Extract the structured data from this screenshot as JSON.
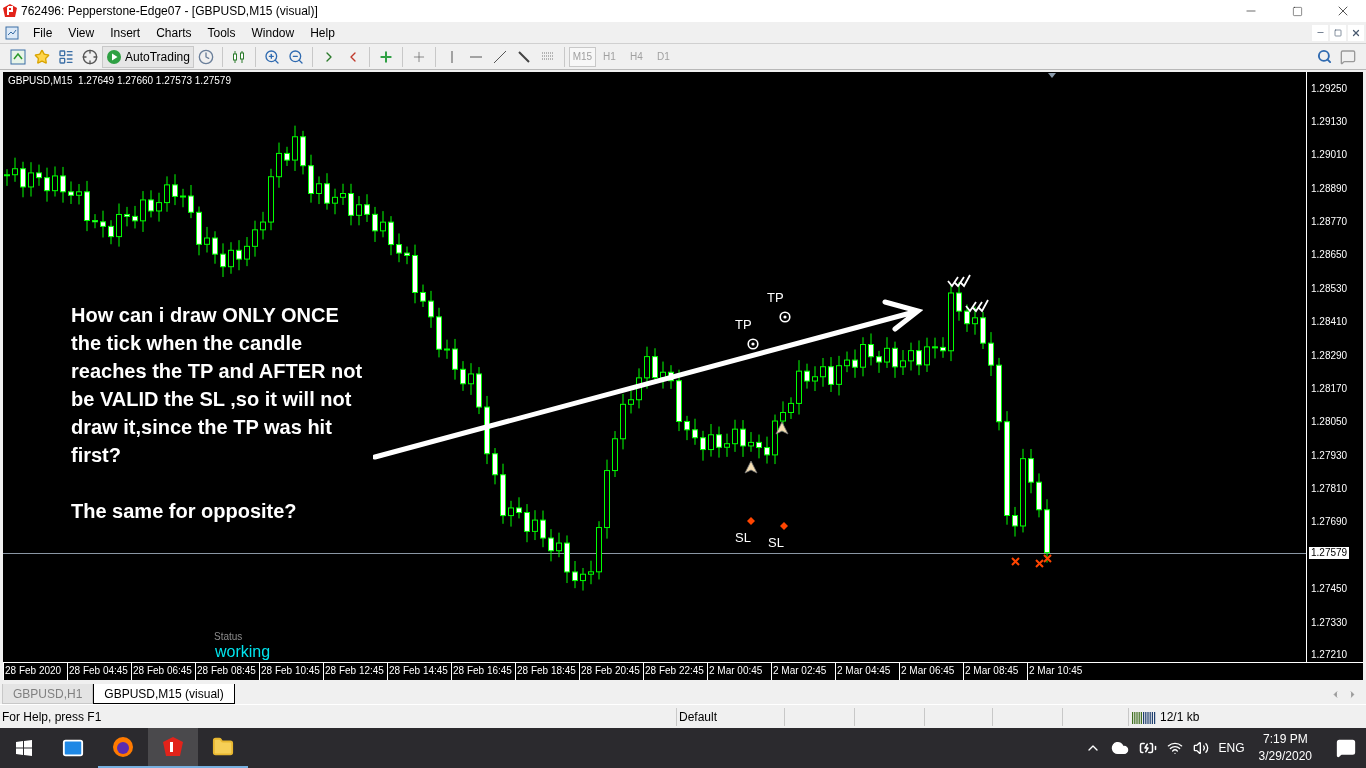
{
  "window": {
    "title": "762496: Pepperstone-Edge07 - [GBPUSD,M15 (visual)]"
  },
  "menu": [
    "File",
    "View",
    "Insert",
    "Charts",
    "Tools",
    "Window",
    "Help"
  ],
  "toolbar": {
    "autotrading": "AutoTrading",
    "timeframes": [
      {
        "label": "M15",
        "selected": true
      },
      {
        "label": "H1",
        "selected": false
      },
      {
        "label": "H4",
        "selected": false
      },
      {
        "label": "D1",
        "selected": false
      }
    ]
  },
  "chart": {
    "info": "GBPUSD,M15  1.27649 1.27660 1.27573 1.27579",
    "price_ticks": [
      "1.29250",
      "1.29130",
      "1.29010",
      "1.28890",
      "1.28770",
      "1.28650",
      "1.28530",
      "1.28410",
      "1.28290",
      "1.28170",
      "1.28050",
      "1.27930",
      "1.27810",
      "1.27690",
      "1.27450",
      "1.27330",
      "1.27210"
    ],
    "current_price": "1.27579",
    "time_labels": [
      "28 Feb 2020",
      "28 Feb 04:45",
      "28 Feb 06:45",
      "28 Feb 08:45",
      "28 Feb 10:45",
      "28 Feb 12:45",
      "28 Feb 14:45",
      "28 Feb 16:45",
      "28 Feb 18:45",
      "28 Feb 20:45",
      "28 Feb 22:45",
      "2 Mar 00:45",
      "2 Mar 02:45",
      "2 Mar 04:45",
      "2 Mar 06:45",
      "2 Mar 08:45",
      "2 Mar 10:45"
    ],
    "note": "How can i draw ONLY ONCE the tick when the candle reaches the TP and AFTER not be VALID the SL ,so it will not draw it,since the TP was hit first?",
    "note_footer": "The same for opposite?",
    "markers": [
      {
        "kind": "tp",
        "label": "TP"
      },
      {
        "kind": "tp",
        "label": "TP"
      },
      {
        "kind": "entry"
      },
      {
        "kind": "entry"
      },
      {
        "kind": "sl",
        "label": "SL"
      },
      {
        "kind": "sl",
        "label": "SL"
      },
      {
        "kind": "check"
      },
      {
        "kind": "check"
      },
      {
        "kind": "cross"
      },
      {
        "kind": "cross"
      },
      {
        "kind": "cross"
      }
    ],
    "status_label": "Status",
    "status_value": "working"
  },
  "tabs": [
    {
      "label": "GBPUSD,H1",
      "selected": false
    },
    {
      "label": "GBPUSD,M15 (visual)",
      "selected": true
    }
  ],
  "status_bar": {
    "help": "For Help, press F1",
    "profile": "Default",
    "traffic": "12/1 kb"
  },
  "taskbar": {
    "language": "ENG",
    "time": "7:19 PM",
    "date": "3/29/2020"
  }
}
